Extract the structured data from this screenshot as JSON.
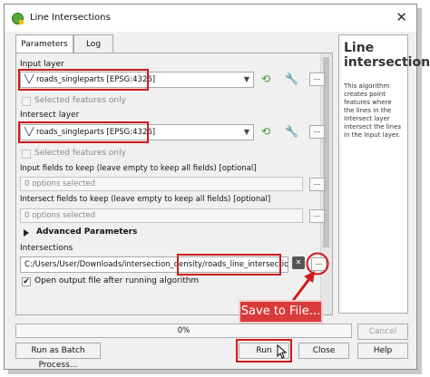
{
  "window": {
    "title": "Line Intersections",
    "close_glyph": "✕"
  },
  "tabs": [
    {
      "label": "Parameters"
    },
    {
      "label": "Log"
    }
  ],
  "input_layer": {
    "label": "Input layer",
    "value": "roads_singleparts [EPSG:4326]",
    "selected_only_label": "Selected features only"
  },
  "intersect_layer": {
    "label": "Intersect layer",
    "value": "roads_singleparts [EPSG:4326]",
    "selected_only_label": "Selected features only"
  },
  "input_fields": {
    "label": "Input fields to keep (leave empty to keep all fields) [optional]",
    "value": "0 options selected"
  },
  "intersect_fields": {
    "label": "Intersect fields to keep (leave empty to keep all fields) [optional]",
    "value": "0 options selected"
  },
  "advanced": {
    "label": "Advanced Parameters"
  },
  "intersections": {
    "label": "Intersections",
    "path_prefix": "C:/Users/User/Downloads/intersection_density/",
    "path_file": "roads_line_intersections.gpkg",
    "open_after_label": "Open output file after running algorithm"
  },
  "help": {
    "title": "Line intersections",
    "body": "This algorithm creates point features where the lines in the Intersect layer intersect the lines in the Input layer."
  },
  "progress": {
    "text": "0%",
    "value": 0
  },
  "buttons": {
    "batch": "Run as Batch Process...",
    "cancel": "Cancel",
    "run": "Run",
    "close": "Close",
    "help": "Help"
  },
  "annotation": {
    "callout": "Save to File..."
  },
  "common": {
    "ellipsis": "...",
    "arrow": "▼",
    "check": "✔"
  },
  "colors": {
    "highlight": "#d11a1a",
    "callout_bg": "#d93a3a"
  },
  "icons": [
    "qgis-logo-icon",
    "line-layer-icon",
    "iterate-icon",
    "wrench-icon",
    "expand-triangle-icon",
    "cursor-icon"
  ]
}
